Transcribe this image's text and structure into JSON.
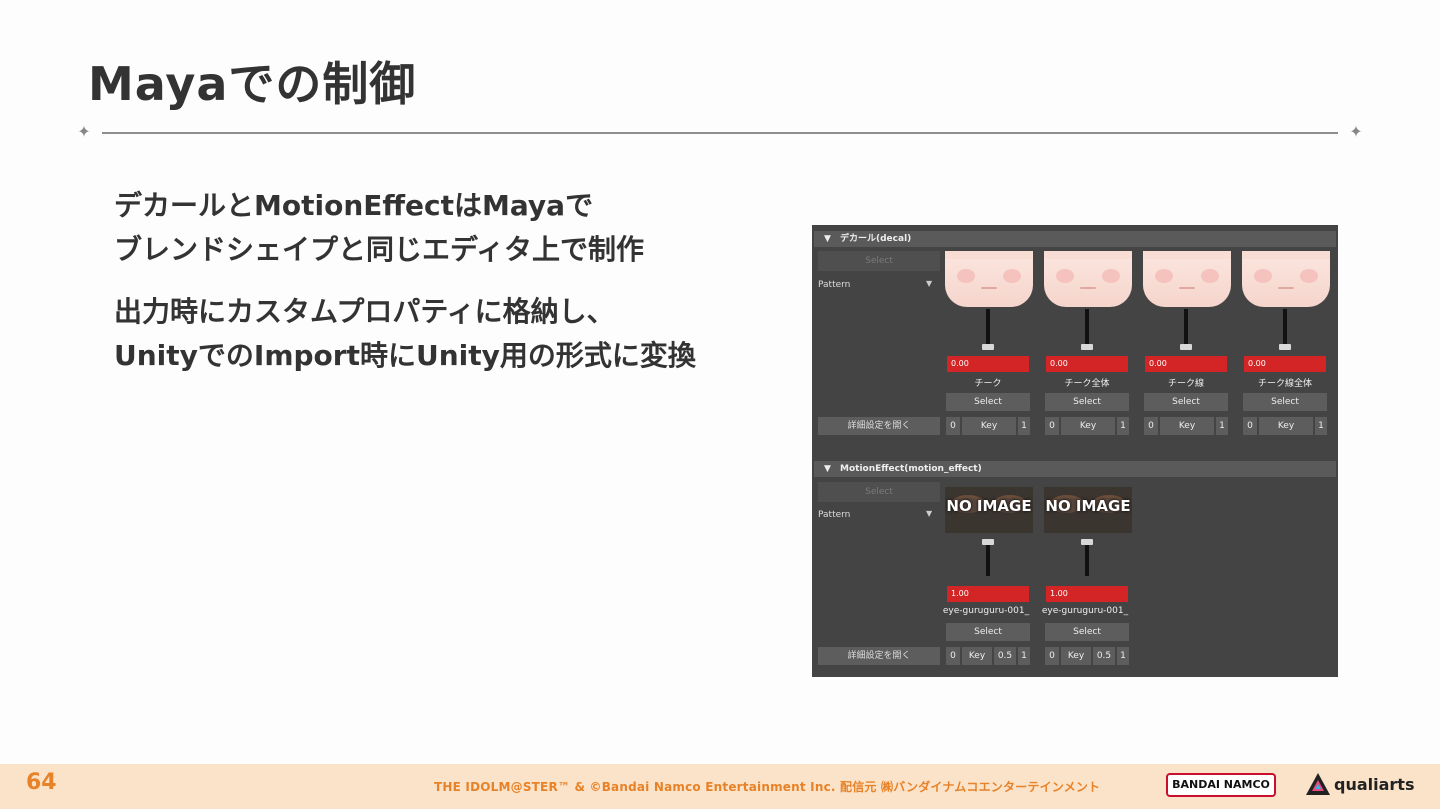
{
  "slide": {
    "title": "Mayaでの制御",
    "bullets": [
      [
        "デカールとMotionEffectはMayaで",
        "ブレンドシェイプと同じエディタ上で制作"
      ],
      [
        "出力時にカスタムプロパティに格納し、",
        "UnityでのImport時にUnity用の形式に変換"
      ]
    ]
  },
  "maya": {
    "decal": {
      "header": "デカール(decal)",
      "select_all": "Select",
      "pattern_label": "Pattern",
      "detail_button": "詳細設定を開く",
      "items": [
        {
          "value": "0.00",
          "caption": "チーク",
          "select": "Select",
          "k0": "0",
          "key": "Key",
          "k1": "1"
        },
        {
          "value": "0.00",
          "caption": "チーク全体",
          "select": "Select",
          "k0": "0",
          "key": "Key",
          "k1": "1"
        },
        {
          "value": "0.00",
          "caption": "チーク線",
          "select": "Select",
          "k0": "0",
          "key": "Key",
          "k1": "1"
        },
        {
          "value": "0.00",
          "caption": "チーク線全体",
          "select": "Select",
          "k0": "0",
          "key": "Key",
          "k1": "1"
        }
      ]
    },
    "motion": {
      "header": "MotionEffect(motion_effect)",
      "select_all": "Select",
      "pattern_label": "Pattern",
      "detail_button": "詳細設定を開く",
      "items": [
        {
          "thumb": "NO IMAGE",
          "value": "1.00",
          "caption": "eye-guruguru-001_",
          "select": "Select",
          "k0": "0",
          "key": "Key",
          "kh": "0.5",
          "k1": "1"
        },
        {
          "thumb": "NO IMAGE",
          "value": "1.00",
          "caption": "eye-guruguru-001_",
          "select": "Select",
          "k0": "0",
          "key": "Key",
          "kh": "0.5",
          "k1": "1"
        }
      ]
    }
  },
  "footer": {
    "page": "64",
    "copyright": "THE IDOLM@STER™ & ©Bandai Namco Entertainment Inc. 配信元 ㈱バンダイナムコエンターテインメント",
    "logo_bandai": "BANDAI NAMCO",
    "logo_qualiarts": "qualiarts"
  },
  "colors": {
    "accent_orange": "#e88228",
    "maya_bg": "#444444",
    "value_red": "#d32525"
  }
}
